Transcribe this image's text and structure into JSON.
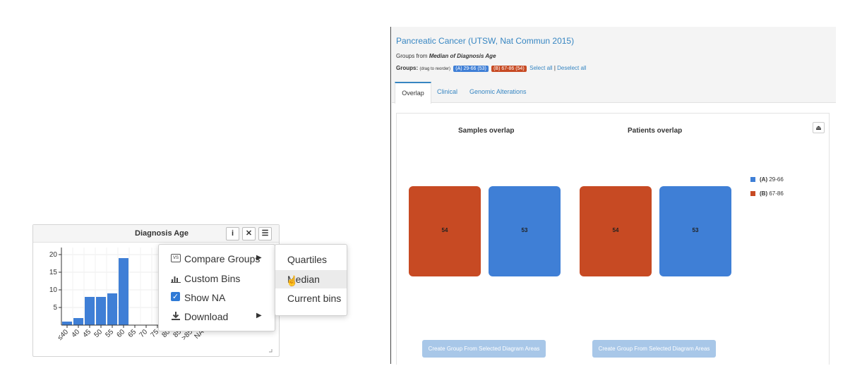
{
  "colors": {
    "accent_blue": "#3786c2",
    "bar_blue": "#3f7fd6",
    "group_a": "#3f7fd6",
    "group_b": "#c74a23",
    "button_disabled": "#a8c7e8"
  },
  "chart_card": {
    "title": "Diagnosis Age",
    "buttons": {
      "info_icon": "info-circle-icon",
      "close_icon": "close-icon",
      "menu_icon": "hamburger-menu-icon"
    }
  },
  "chart_data": {
    "type": "bar",
    "title": "",
    "xlabel": "",
    "ylabel": "",
    "categories": [
      "≤40",
      "40",
      "45",
      "50",
      "55",
      "60",
      "65",
      "70",
      "75",
      "80",
      "85",
      ">85",
      "NA"
    ],
    "values": [
      1,
      2,
      8,
      8,
      9,
      19,
      0,
      0,
      0,
      0,
      0,
      0,
      0
    ],
    "ylim": [
      0,
      22
    ],
    "yticks": [
      5,
      10,
      15,
      20
    ],
    "grid": true,
    "legend": "none"
  },
  "menu": {
    "items": [
      {
        "icon": "vs-icon",
        "label": "Compare Groups",
        "has_submenu": true
      },
      {
        "icon": "bar-chart-icon",
        "label": "Custom Bins",
        "has_submenu": false
      },
      {
        "icon": "checkbox-checked-icon",
        "label": "Show NA",
        "has_submenu": false
      },
      {
        "icon": "download-icon",
        "label": "Download",
        "has_submenu": true
      }
    ],
    "submenu": [
      "Quartiles",
      "Median",
      "Current bins"
    ]
  },
  "study": {
    "title": "Pancreatic Cancer (UTSW, Nat Commun 2015)",
    "groups_from_prefix": "Groups from ",
    "groups_from_value": "Median of Diagnosis Age",
    "groups_label": "Groups:",
    "drag_hint": "(drag to reorder)",
    "group_a_badge": "(A) 29-66 (53)",
    "group_b_badge": "(B) 67-86 (54)",
    "select_all": "Select all",
    "separator": "|",
    "deselect_all": "Deselect all"
  },
  "tabs": [
    "Overlap",
    "Clinical",
    "Genomic Alterations"
  ],
  "overlap": {
    "samples_title": "Samples overlap",
    "patients_title": "Patients overlap",
    "samples": {
      "b_count": "54",
      "a_count": "53"
    },
    "patients": {
      "b_count": "54",
      "a_count": "53"
    },
    "legend": [
      {
        "key": "(A)",
        "label": "29-66"
      },
      {
        "key": "(B)",
        "label": "67-86"
      }
    ],
    "create_button_label": "Create Group From Selected Diagram Areas",
    "download_icon": "cloud-download-icon"
  }
}
